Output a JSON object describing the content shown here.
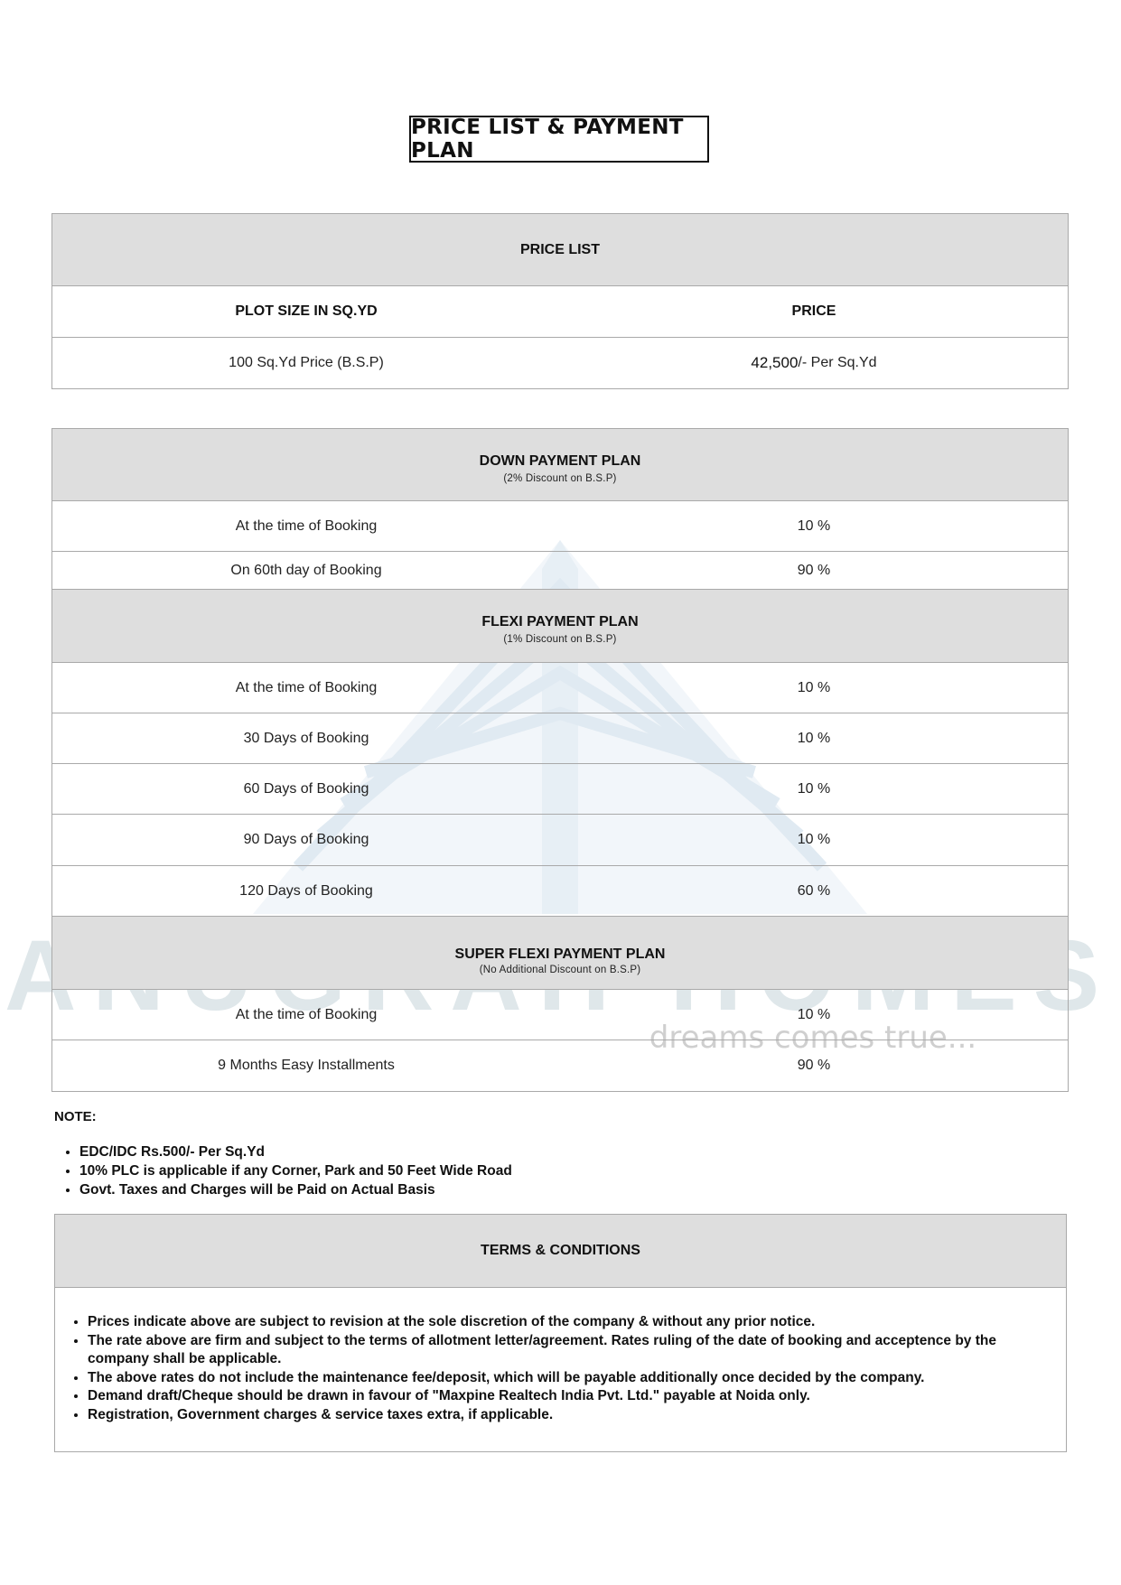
{
  "title": "PRICE LIST & PAYMENT PLAN",
  "watermark": {
    "brand": "ANUGRAH HOMES",
    "tagline": "dreams comes true..."
  },
  "price_list": {
    "header": "PRICE LIST",
    "col_size": "PLOT SIZE IN SQ.YD",
    "col_price": "PRICE",
    "row_label": "100 Sq.Yd Price (B.S.P)",
    "row_amount": "42,500",
    "row_unit": "/- Per Sq.Yd"
  },
  "down_payment": {
    "header": "DOWN PAYMENT PLAN",
    "sub": "(2% Discount on B.S.P)",
    "rows": [
      {
        "label": "At the time of Booking",
        "value": "10 %"
      },
      {
        "label": "On 60th day of Booking",
        "value": "90 %"
      }
    ]
  },
  "flexi_payment": {
    "header": "FLEXI PAYMENT PLAN",
    "sub": "(1% Discount on B.S.P)",
    "rows": [
      {
        "label": "At the time of Booking",
        "value": "10 %"
      },
      {
        "label": "30 Days of Booking",
        "value": "10 %"
      },
      {
        "label": "60 Days of Booking",
        "value": "10 %"
      },
      {
        "label": "90 Days of Booking",
        "value": "10 %"
      },
      {
        "label": "120 Days of Booking",
        "value": "60 %"
      }
    ]
  },
  "super_flexi": {
    "header": "SUPER FLEXI PAYMENT PLAN",
    "sub": "(No Additional Discount on B.S.P)",
    "rows": [
      {
        "label": "At the time of Booking",
        "value": "10 %"
      },
      {
        "label": "9 Months Easy Installments",
        "value": "90 %"
      }
    ]
  },
  "note": {
    "label": "NOTE:",
    "items": [
      "EDC/IDC Rs.500/- Per Sq.Yd",
      "10% PLC is applicable if any Corner, Park and 50 Feet Wide Road",
      "Govt. Taxes and Charges will be Paid on Actual Basis"
    ]
  },
  "terms": {
    "header": "TERMS & CONDITIONS",
    "items": [
      "Prices indicate above are subject to revision at the sole discretion of the company & without any prior notice.",
      "The rate above are firm and subject to the terms of allotment letter/agreement. Rates ruling of the date of booking and acceptence by the company shall be applicable.",
      "The above rates do not include the maintenance fee/deposit, which will be payable additionally once decided by the company.",
      "Demand draft/Cheque should be drawn in favour of \"Maxpine Realtech India Pvt. Ltd.\" payable at Noida only.",
      "Registration, Government charges & service taxes extra, if applicable."
    ]
  }
}
